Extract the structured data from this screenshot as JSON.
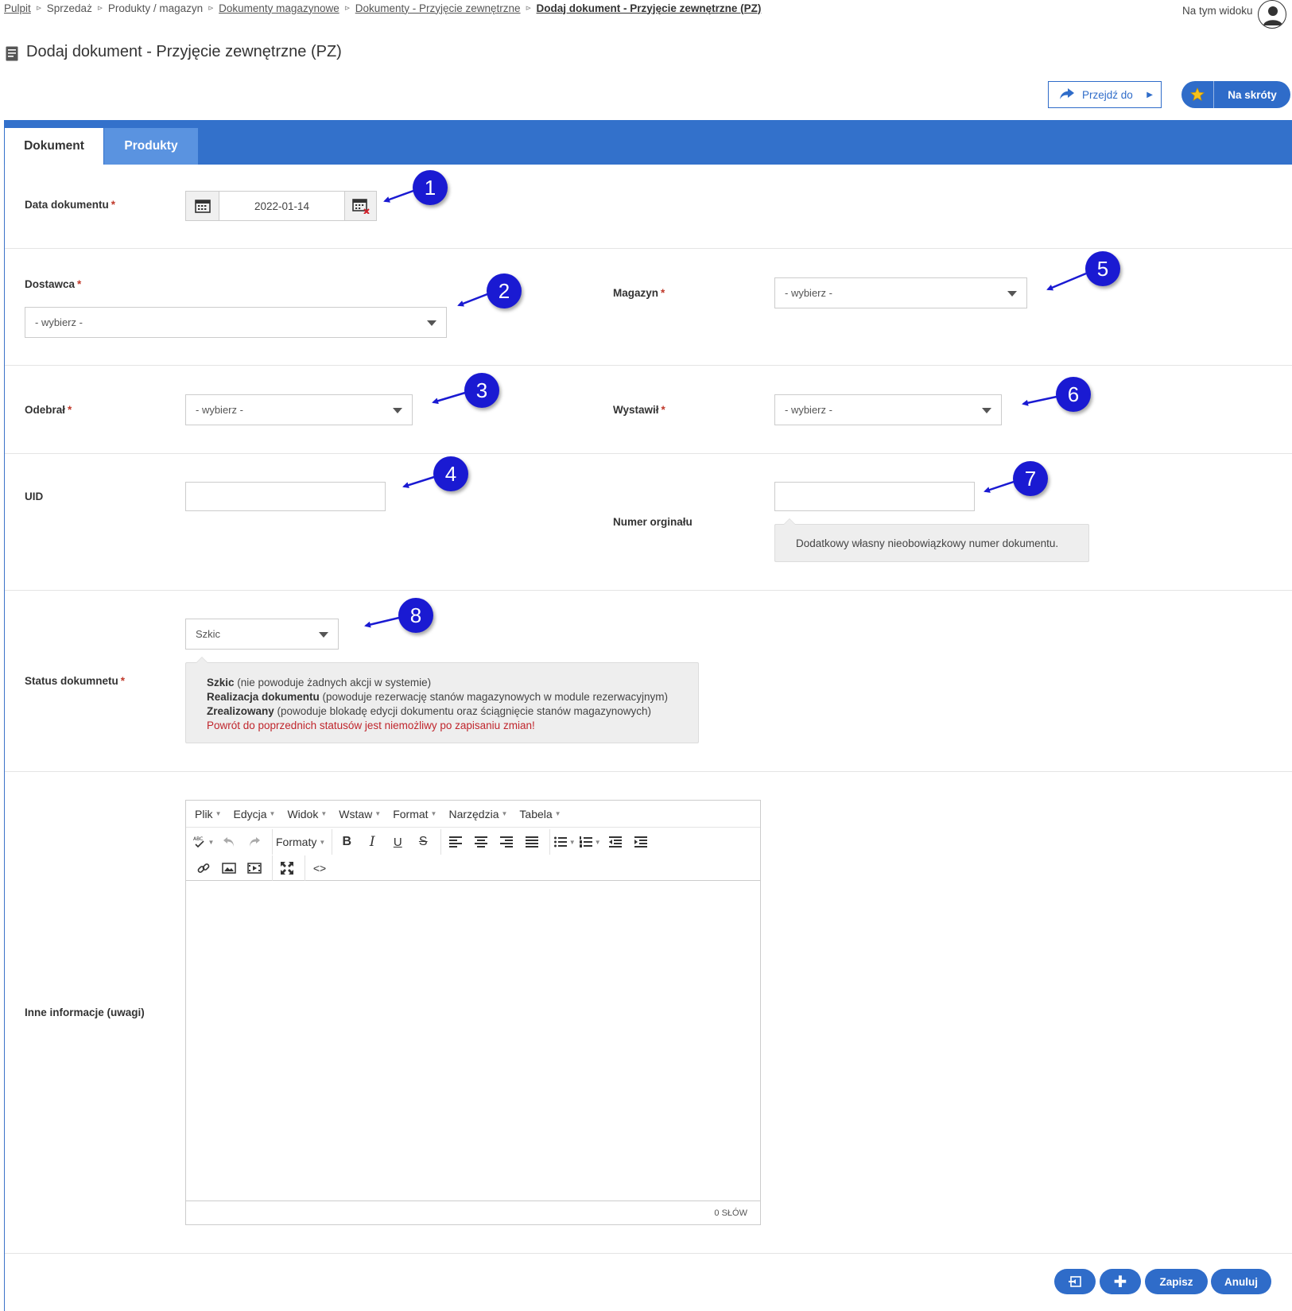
{
  "breadcrumb": [
    {
      "label": "Pulpit",
      "link": true
    },
    {
      "label": "Sprzedaż",
      "link": false
    },
    {
      "label": "Produkty / magazyn",
      "link": false
    },
    {
      "label": "Dokumenty magazynowe",
      "link": true
    },
    {
      "label": "Dokumenty - Przyjęcie zewnętrzne",
      "link": true
    },
    {
      "label": "Dodaj dokument - Przyjęcie zewnętrzne (PZ)",
      "link": true,
      "current": true
    }
  ],
  "header": {
    "view_label": "Na tym widoku",
    "title": "Dodaj dokument - Przyjęcie zewnętrzne (PZ)",
    "goto_label": "Przejdź do",
    "shortcuts_label": "Na skróty"
  },
  "tabs": [
    {
      "label": "Dokument",
      "active": true
    },
    {
      "label": "Produkty",
      "active": false
    }
  ],
  "form": {
    "date_label": "Data dokumentu",
    "date_value": "2022-01-14",
    "supplier_label": "Dostawca",
    "supplier_value": "- wybierz -",
    "warehouse_label": "Magazyn",
    "warehouse_value": "- wybierz -",
    "received_label": "Odebrał",
    "received_value": "- wybierz -",
    "issued_label": "Wystawił",
    "issued_value": "- wybierz -",
    "uid_label": "UID",
    "uid_value": "",
    "original_number_label": "Numer orginału",
    "original_number_value": "",
    "original_number_hint": "Dodatkowy własny nieobowiązkowy numer dokumentu.",
    "status_label": "Status dokumnetu",
    "status_value": "Szkic",
    "status_hint": {
      "line1_bold": "Szkic",
      "line1_rest": " (nie powoduje żadnych akcji w systemie)",
      "line2_bold": "Realizacja dokumentu",
      "line2_rest": " (powoduje rezerwację stanów magazynowych w module rezerwacyjnym)",
      "line3_bold": "Zrealizowany",
      "line3_rest": " (powoduje blokadę edycji dokumentu oraz ściągnięcie stanów magazynowych)",
      "warning": "Powrót do poprzednich statusów jest niemożliwy po zapisaniu zmian!"
    },
    "notes_label": "Inne informacje (uwagi)",
    "required_mark": "*"
  },
  "editor": {
    "menu": [
      "Plik",
      "Edycja",
      "Widok",
      "Wstaw",
      "Format",
      "Narzędzia",
      "Tabela"
    ],
    "formats_label": "Formaty",
    "word_count": "0 SŁÓW",
    "toolbar_icons": [
      "spellcheck-icon",
      "undo-icon",
      "redo-icon",
      "bold-icon",
      "italic-icon",
      "underline-icon",
      "strikethrough-icon",
      "align-left-icon",
      "align-center-icon",
      "align-right-icon",
      "align-justify-icon",
      "bullet-list-icon",
      "numbered-list-icon",
      "outdent-icon",
      "indent-icon",
      "link-icon",
      "image-icon",
      "media-icon",
      "fullscreen-icon",
      "source-code-icon"
    ]
  },
  "actions": {
    "save_label": "Zapisz",
    "cancel_label": "Anuluj"
  },
  "annotations": [
    "1",
    "2",
    "3",
    "4",
    "5",
    "6",
    "7",
    "8"
  ],
  "colors": {
    "primary": "#2f6cc9",
    "tabbar": "#3371cb",
    "tab_inactive": "#5a93e0",
    "marker": "#1a1ad2",
    "required": "#c0392b",
    "warning": "#c0262d"
  }
}
